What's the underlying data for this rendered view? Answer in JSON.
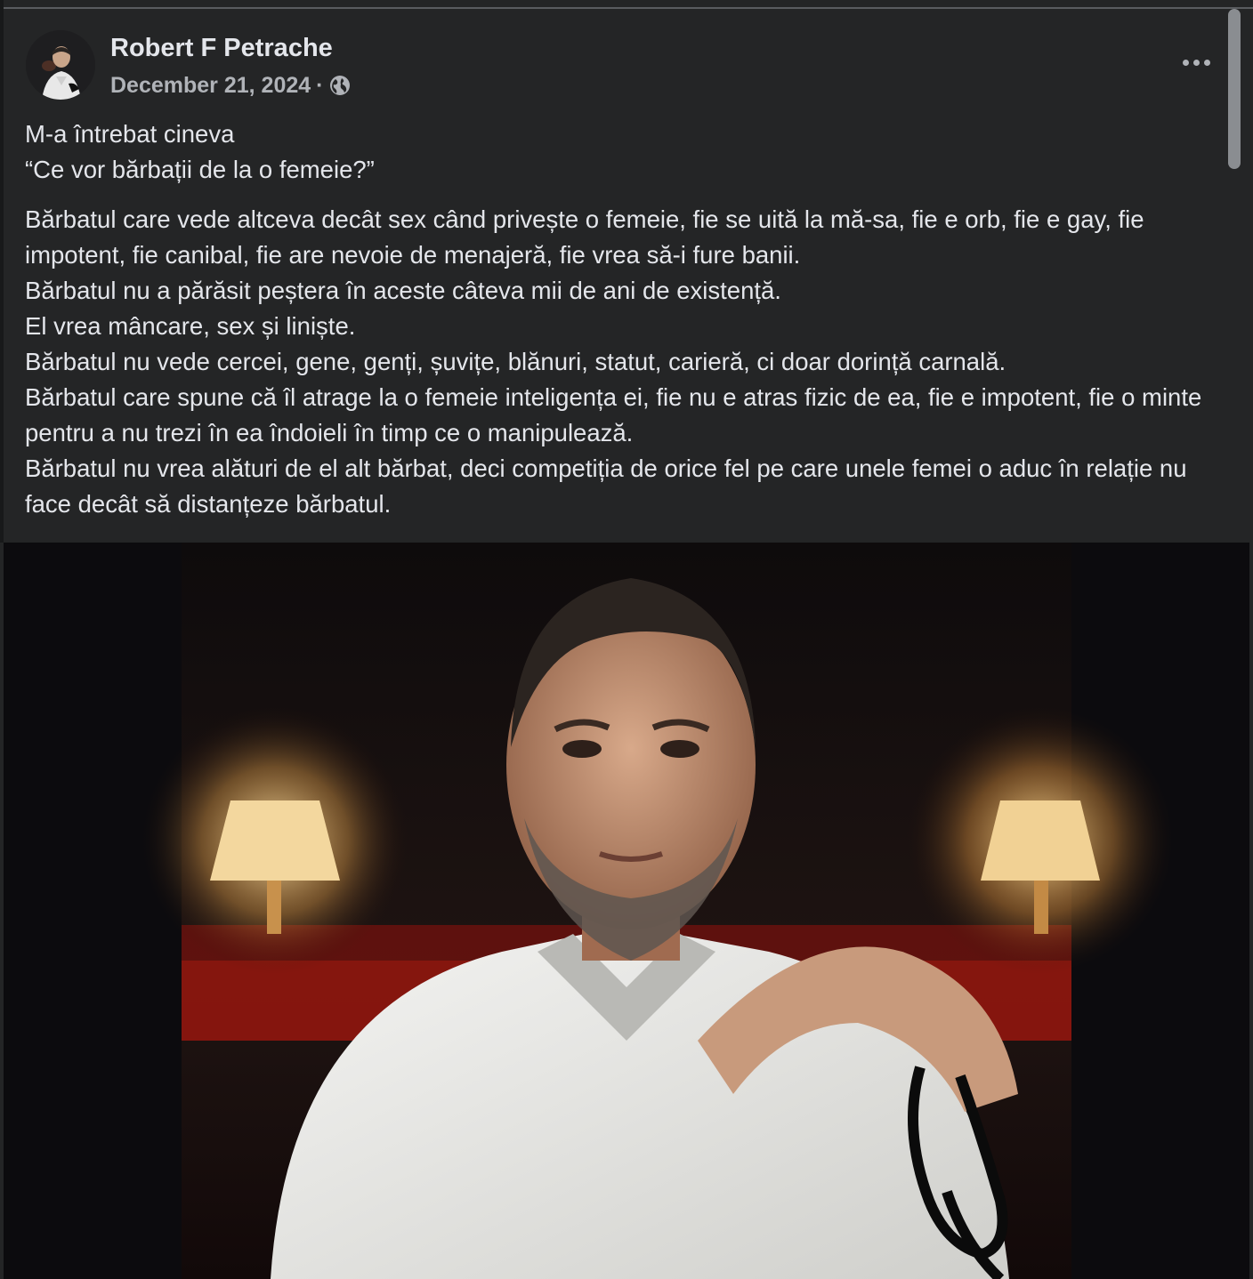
{
  "post": {
    "author": "Robert F Petrache",
    "date": "December 21, 2024",
    "separator": "·",
    "privacy_icon": "globe-icon",
    "more_icon": "more-horizontal-icon",
    "intro": [
      "M-a întrebat cineva",
      "“Ce vor bărbații de la o femeie?”"
    ],
    "body": [
      "Bărbatul care vede altceva decât sex când privește o femeie, fie se uită la mă-sa, fie e orb, fie e gay, fie impotent, fie canibal, fie are nevoie de menajeră, fie vrea să-i fure banii.",
      "Bărbatul nu a părăsit peștera în aceste câteva mii de ani de existență.",
      "El vrea mâncare, sex și liniște.",
      "Bărbatul nu vede cercei, gene, genți, șuvițe, blănuri, statut, carieră, ci doar dorință carnală.",
      "Bărbatul care spune că îl atrage la o  femeie inteligența ei, fie nu e atras fizic de ea, fie e impotent, fie o minte pentru a nu trezi în ea îndoieli în timp ce o manipulează.",
      "Bărbatul nu vrea alături de el alt bărbat, deci competiția de orice fel pe care unele femei o aduc în relație nu face decât să distanțeze bărbatul."
    ]
  },
  "colors": {
    "card_bg": "#242526",
    "text_primary": "#e4e6eb",
    "text_secondary": "#b0b3b8"
  }
}
